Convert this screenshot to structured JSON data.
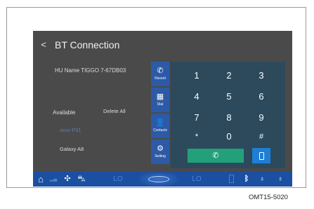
{
  "header": {
    "back_icon": "<",
    "title": "BT Connection"
  },
  "left_panel": {
    "hu_name": "HU Name TIGGO 7-67DB03",
    "available_label": "Available",
    "delete_all_label": "Delete All",
    "devices": [
      "xxxx P31",
      "Galaxy A8"
    ]
  },
  "side_tabs": [
    {
      "label": "Recent",
      "icon": "phone-recent-icon",
      "glyph": "✆"
    },
    {
      "label": "Dial",
      "icon": "dialpad-icon",
      "glyph": "▦"
    },
    {
      "label": "Contacts",
      "icon": "person-icon",
      "glyph": "👤"
    },
    {
      "label": "Setting",
      "icon": "gear-icon",
      "glyph": "⚙"
    }
  ],
  "dialpad": {
    "keys": [
      "1",
      "2",
      "3",
      "4",
      "5",
      "6",
      "7",
      "8",
      "9",
      "*",
      "0",
      "#"
    ],
    "call_glyph": "✆"
  },
  "bottom_bar": {
    "home_glyph": "⌂",
    "signal_glyph": "▂▄",
    "fan_glyph": "✣",
    "car_glyph": "⛍",
    "lo_left": "LO",
    "lo_right": "LO",
    "bluetooth_glyph": "ᛒ",
    "seat_left_glyph": "♁",
    "seat_right_glyph": "♁"
  },
  "caption": "OMT15-5020",
  "colors": {
    "screen_bg": "#4a4a4a",
    "dialpad_bg": "#2c4a5c",
    "tab_bg": "#2d5aa6",
    "call_green": "#23a07a",
    "accent_blue": "#1e7fd4",
    "bottom_bar": "#1b4fa2"
  }
}
